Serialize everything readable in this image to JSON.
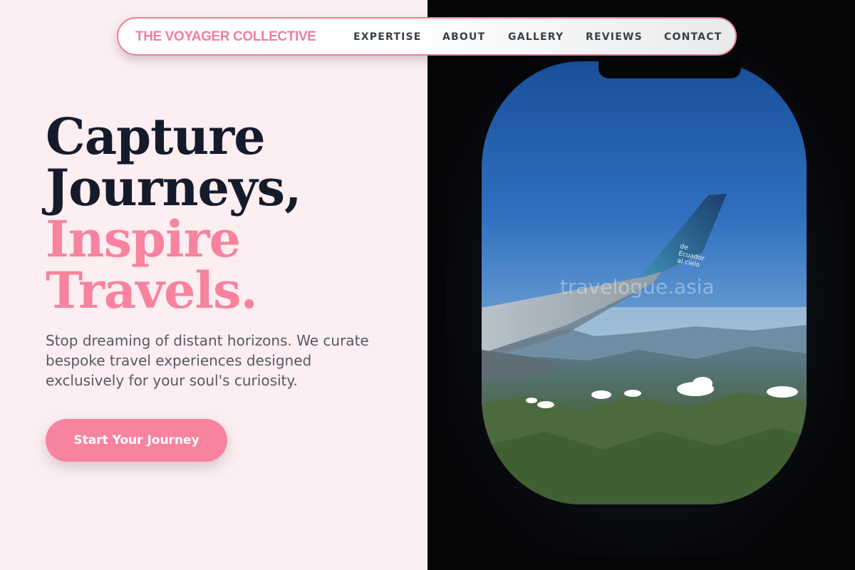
{
  "nav": {
    "brand": "THE VOYAGER COLLECTIVE",
    "links": [
      "EXPERTISE",
      "ABOUT",
      "GALLERY",
      "REVIEWS",
      "CONTACT"
    ]
  },
  "hero": {
    "title_line1": "Capture",
    "title_line2": "Journeys,",
    "title_line3": "Inspire",
    "title_line4": "Travels.",
    "subtitle": "Stop dreaming of distant horizons. We curate bespoke travel experiences designed exclusively for your soul's curiosity.",
    "cta_label": "Start Your Journey"
  },
  "image": {
    "watermark": "travelogue.asia",
    "wing_text": "de Ecuador al cielo"
  },
  "colors": {
    "accent_pink": "#f7839f",
    "brand_pink": "#f07f9a",
    "heading_dark": "#161b2b",
    "background": "#fdeef1"
  }
}
